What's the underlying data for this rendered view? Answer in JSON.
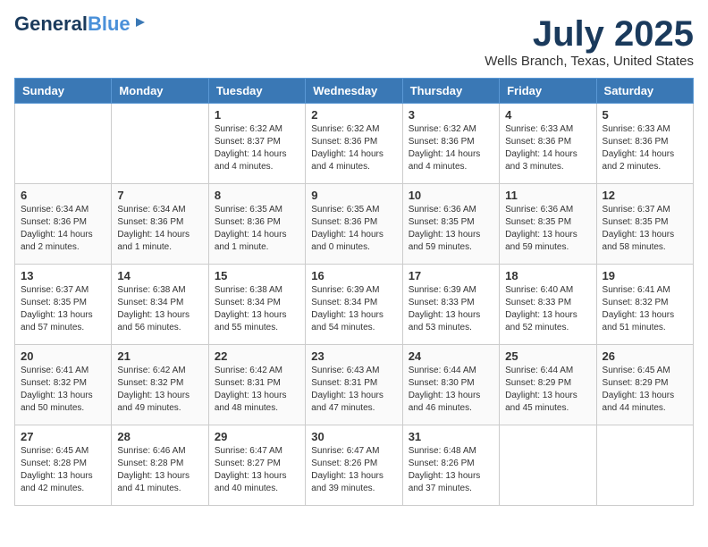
{
  "logo": {
    "line1": "General",
    "line2": "Blue",
    "icon": "▶"
  },
  "title": "July 2025",
  "location": "Wells Branch, Texas, United States",
  "weekdays": [
    "Sunday",
    "Monday",
    "Tuesday",
    "Wednesday",
    "Thursday",
    "Friday",
    "Saturday"
  ],
  "weeks": [
    [
      {
        "day": "",
        "content": ""
      },
      {
        "day": "",
        "content": ""
      },
      {
        "day": "1",
        "content": "Sunrise: 6:32 AM\nSunset: 8:37 PM\nDaylight: 14 hours and 4 minutes."
      },
      {
        "day": "2",
        "content": "Sunrise: 6:32 AM\nSunset: 8:36 PM\nDaylight: 14 hours and 4 minutes."
      },
      {
        "day": "3",
        "content": "Sunrise: 6:32 AM\nSunset: 8:36 PM\nDaylight: 14 hours and 4 minutes."
      },
      {
        "day": "4",
        "content": "Sunrise: 6:33 AM\nSunset: 8:36 PM\nDaylight: 14 hours and 3 minutes."
      },
      {
        "day": "5",
        "content": "Sunrise: 6:33 AM\nSunset: 8:36 PM\nDaylight: 14 hours and 2 minutes."
      }
    ],
    [
      {
        "day": "6",
        "content": "Sunrise: 6:34 AM\nSunset: 8:36 PM\nDaylight: 14 hours and 2 minutes."
      },
      {
        "day": "7",
        "content": "Sunrise: 6:34 AM\nSunset: 8:36 PM\nDaylight: 14 hours and 1 minute."
      },
      {
        "day": "8",
        "content": "Sunrise: 6:35 AM\nSunset: 8:36 PM\nDaylight: 14 hours and 1 minute."
      },
      {
        "day": "9",
        "content": "Sunrise: 6:35 AM\nSunset: 8:36 PM\nDaylight: 14 hours and 0 minutes."
      },
      {
        "day": "10",
        "content": "Sunrise: 6:36 AM\nSunset: 8:35 PM\nDaylight: 13 hours and 59 minutes."
      },
      {
        "day": "11",
        "content": "Sunrise: 6:36 AM\nSunset: 8:35 PM\nDaylight: 13 hours and 59 minutes."
      },
      {
        "day": "12",
        "content": "Sunrise: 6:37 AM\nSunset: 8:35 PM\nDaylight: 13 hours and 58 minutes."
      }
    ],
    [
      {
        "day": "13",
        "content": "Sunrise: 6:37 AM\nSunset: 8:35 PM\nDaylight: 13 hours and 57 minutes."
      },
      {
        "day": "14",
        "content": "Sunrise: 6:38 AM\nSunset: 8:34 PM\nDaylight: 13 hours and 56 minutes."
      },
      {
        "day": "15",
        "content": "Sunrise: 6:38 AM\nSunset: 8:34 PM\nDaylight: 13 hours and 55 minutes."
      },
      {
        "day": "16",
        "content": "Sunrise: 6:39 AM\nSunset: 8:34 PM\nDaylight: 13 hours and 54 minutes."
      },
      {
        "day": "17",
        "content": "Sunrise: 6:39 AM\nSunset: 8:33 PM\nDaylight: 13 hours and 53 minutes."
      },
      {
        "day": "18",
        "content": "Sunrise: 6:40 AM\nSunset: 8:33 PM\nDaylight: 13 hours and 52 minutes."
      },
      {
        "day": "19",
        "content": "Sunrise: 6:41 AM\nSunset: 8:32 PM\nDaylight: 13 hours and 51 minutes."
      }
    ],
    [
      {
        "day": "20",
        "content": "Sunrise: 6:41 AM\nSunset: 8:32 PM\nDaylight: 13 hours and 50 minutes."
      },
      {
        "day": "21",
        "content": "Sunrise: 6:42 AM\nSunset: 8:32 PM\nDaylight: 13 hours and 49 minutes."
      },
      {
        "day": "22",
        "content": "Sunrise: 6:42 AM\nSunset: 8:31 PM\nDaylight: 13 hours and 48 minutes."
      },
      {
        "day": "23",
        "content": "Sunrise: 6:43 AM\nSunset: 8:31 PM\nDaylight: 13 hours and 47 minutes."
      },
      {
        "day": "24",
        "content": "Sunrise: 6:44 AM\nSunset: 8:30 PM\nDaylight: 13 hours and 46 minutes."
      },
      {
        "day": "25",
        "content": "Sunrise: 6:44 AM\nSunset: 8:29 PM\nDaylight: 13 hours and 45 minutes."
      },
      {
        "day": "26",
        "content": "Sunrise: 6:45 AM\nSunset: 8:29 PM\nDaylight: 13 hours and 44 minutes."
      }
    ],
    [
      {
        "day": "27",
        "content": "Sunrise: 6:45 AM\nSunset: 8:28 PM\nDaylight: 13 hours and 42 minutes."
      },
      {
        "day": "28",
        "content": "Sunrise: 6:46 AM\nSunset: 8:28 PM\nDaylight: 13 hours and 41 minutes."
      },
      {
        "day": "29",
        "content": "Sunrise: 6:47 AM\nSunset: 8:27 PM\nDaylight: 13 hours and 40 minutes."
      },
      {
        "day": "30",
        "content": "Sunrise: 6:47 AM\nSunset: 8:26 PM\nDaylight: 13 hours and 39 minutes."
      },
      {
        "day": "31",
        "content": "Sunrise: 6:48 AM\nSunset: 8:26 PM\nDaylight: 13 hours and 37 minutes."
      },
      {
        "day": "",
        "content": ""
      },
      {
        "day": "",
        "content": ""
      }
    ]
  ]
}
